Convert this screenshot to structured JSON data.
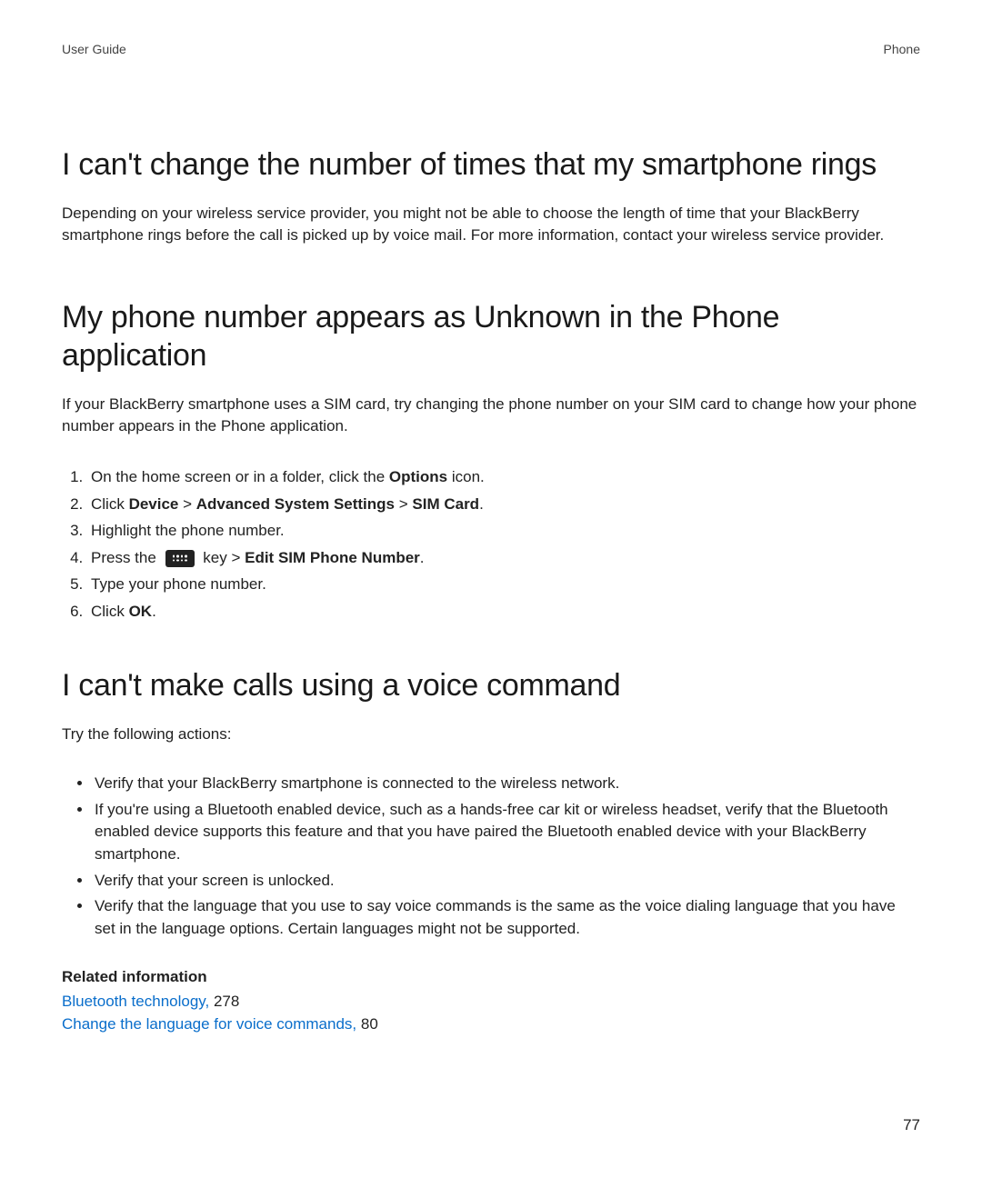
{
  "header": {
    "left": "User Guide",
    "right": "Phone"
  },
  "section1": {
    "heading": "I can't change the number of times that my smartphone rings",
    "body": "Depending on your wireless service provider, you might not be able to choose the length of time that your BlackBerry smartphone rings before the call is picked up by voice mail. For more information, contact your wireless service provider."
  },
  "section2": {
    "heading": "My phone number appears as Unknown in the Phone application",
    "body": "If your BlackBerry smartphone uses a SIM card, try changing the phone number on your SIM card to change how your phone number appears in the Phone application.",
    "steps": {
      "s1_pre": "On the home screen or in a folder, click the ",
      "s1_bold": "Options",
      "s1_post": " icon.",
      "s2_pre": "Click ",
      "s2_b1": "Device",
      "s2_sep1": " > ",
      "s2_b2": "Advanced System Settings",
      "s2_sep2": " > ",
      "s2_b3": "SIM Card",
      "s2_post": ".",
      "s3": "Highlight the phone number.",
      "s4_pre": "Press the ",
      "s4_mid": " key > ",
      "s4_bold": "Edit SIM Phone Number",
      "s4_post": ".",
      "s5": "Type your phone number.",
      "s6_pre": "Click ",
      "s6_bold": "OK",
      "s6_post": "."
    }
  },
  "section3": {
    "heading": "I can't make calls using a voice command",
    "body": "Try the following actions:",
    "bullets": {
      "b1": "Verify that your BlackBerry smartphone is connected to the wireless network.",
      "b2": "If you're using a Bluetooth enabled device, such as a hands-free car kit or wireless headset, verify that the Bluetooth enabled device supports this feature and that you have paired the Bluetooth enabled device with your BlackBerry smartphone.",
      "b3": "Verify that your screen is unlocked.",
      "b4": "Verify that the language that you use to say voice commands is the same as the voice dialing language that you have set in the language options. Certain languages might not be supported."
    }
  },
  "related": {
    "heading": "Related information",
    "link1_text": "Bluetooth technology,",
    "link1_page": " 278",
    "link2_text": "Change the language for voice commands,",
    "link2_page": " 80"
  },
  "page_number": "77"
}
